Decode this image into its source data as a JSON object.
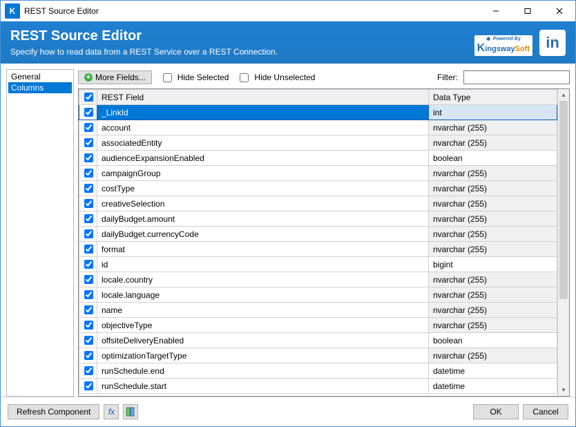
{
  "window": {
    "title": "REST Source Editor"
  },
  "header": {
    "title": "REST Source Editor",
    "subtitle": "Specify how to read data from a REST Service over a REST Connection.",
    "poweredBy": "Powered By",
    "company": "KingswaySoft",
    "linkedin": "in"
  },
  "sidebar": {
    "items": [
      {
        "label": "General",
        "selected": false
      },
      {
        "label": "Columns",
        "selected": true
      }
    ]
  },
  "toolbar": {
    "moreFields": "More Fields...",
    "hideSelected": "Hide Selected",
    "hideUnselected": "Hide Unselected",
    "hideSelectedChecked": false,
    "hideUnselectedChecked": false,
    "filterLabel": "Filter:",
    "filterValue": ""
  },
  "grid": {
    "headers": {
      "checkbox": true,
      "field": "REST Field",
      "dataType": "Data Type"
    },
    "rows": [
      {
        "checked": true,
        "field": "_LinkId",
        "dataType": "int",
        "selected": true,
        "dtWhite": false
      },
      {
        "checked": true,
        "field": "account",
        "dataType": "nvarchar (255)",
        "dtWhite": false
      },
      {
        "checked": true,
        "field": "associatedEntity",
        "dataType": "nvarchar (255)",
        "dtWhite": false
      },
      {
        "checked": true,
        "field": "audienceExpansionEnabled",
        "dataType": "boolean",
        "dtWhite": true
      },
      {
        "checked": true,
        "field": "campaignGroup",
        "dataType": "nvarchar (255)",
        "dtWhite": false
      },
      {
        "checked": true,
        "field": "costType",
        "dataType": "nvarchar (255)",
        "dtWhite": false
      },
      {
        "checked": true,
        "field": "creativeSelection",
        "dataType": "nvarchar (255)",
        "dtWhite": false
      },
      {
        "checked": true,
        "field": "dailyBudget.amount",
        "dataType": "nvarchar (255)",
        "dtWhite": false
      },
      {
        "checked": true,
        "field": "dailyBudget.currencyCode",
        "dataType": "nvarchar (255)",
        "dtWhite": false
      },
      {
        "checked": true,
        "field": "format",
        "dataType": "nvarchar (255)",
        "dtWhite": false
      },
      {
        "checked": true,
        "field": "id",
        "dataType": "bigint",
        "dtWhite": true
      },
      {
        "checked": true,
        "field": "locale.country",
        "dataType": "nvarchar (255)",
        "dtWhite": false
      },
      {
        "checked": true,
        "field": "locale.language",
        "dataType": "nvarchar (255)",
        "dtWhite": false
      },
      {
        "checked": true,
        "field": "name",
        "dataType": "nvarchar (255)",
        "dtWhite": false
      },
      {
        "checked": true,
        "field": "objectiveType",
        "dataType": "nvarchar (255)",
        "dtWhite": false
      },
      {
        "checked": true,
        "field": "offsiteDeliveryEnabled",
        "dataType": "boolean",
        "dtWhite": true
      },
      {
        "checked": true,
        "field": "optimizationTargetType",
        "dataType": "nvarchar (255)",
        "dtWhite": false
      },
      {
        "checked": true,
        "field": "runSchedule.end",
        "dataType": "datetime",
        "dtWhite": true
      },
      {
        "checked": true,
        "field": "runSchedule.start",
        "dataType": "datetime",
        "dtWhite": true
      }
    ]
  },
  "footer": {
    "refresh": "Refresh Component",
    "fx": "fx",
    "ok": "OK",
    "cancel": "Cancel"
  }
}
